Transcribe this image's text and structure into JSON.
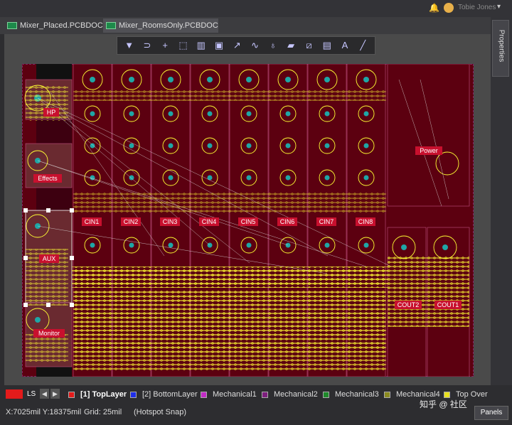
{
  "topbar": {
    "user_name": "Tobie Jones"
  },
  "tabs": [
    {
      "label": "Mixer_Placed.PCBDOC *"
    },
    {
      "label": "Mixer_RoomsOnly.PCBDOC *"
    }
  ],
  "side_panel": {
    "properties_label": "Properties"
  },
  "toolbar": {
    "icons": [
      "filter-icon",
      "route-icon",
      "plus-icon",
      "select-rect-icon",
      "bar-chart-icon",
      "component-icon",
      "path-icon",
      "wave-icon",
      "pin-icon",
      "shape-icon",
      "line-draw-icon",
      "chart-icon",
      "text-icon",
      "line-icon"
    ]
  },
  "board": {
    "rooms": [
      "HP",
      "Effects",
      "AUX",
      "Monitor",
      "Power",
      "COUT2",
      "COUT1"
    ],
    "channels": [
      "CIN1",
      "CIN2",
      "CIN3",
      "CIN4",
      "CIN5",
      "CIN6",
      "CIN7",
      "CIN8"
    ]
  },
  "colors": {
    "board": "#5c0010",
    "room_label": "#c8102e",
    "tracks": "#ffff33",
    "pads": "#1fa6a6"
  },
  "layers": {
    "ls_label": "LS",
    "items": [
      {
        "label": "[1] TopLayer",
        "color": "#e31b1b"
      },
      {
        "label": "[2] BottomLayer",
        "color": "#1f2ee8"
      },
      {
        "label": "Mechanical1",
        "color": "#c22bc6"
      },
      {
        "label": "Mechanical2",
        "color": "#7d1f7d"
      },
      {
        "label": "Mechanical3",
        "color": "#1f8a2b"
      },
      {
        "label": "Mechanical4",
        "color": "#8a8a1f"
      },
      {
        "label": "Top Over",
        "color": "#e8e01f"
      }
    ]
  },
  "status": {
    "coords": "X:7025mil Y:18375mil",
    "grid": "Grid: 25mil",
    "snap": "(Hotspot Snap)",
    "watermark": "知乎 @ 社区",
    "panels_label": "Panels"
  }
}
